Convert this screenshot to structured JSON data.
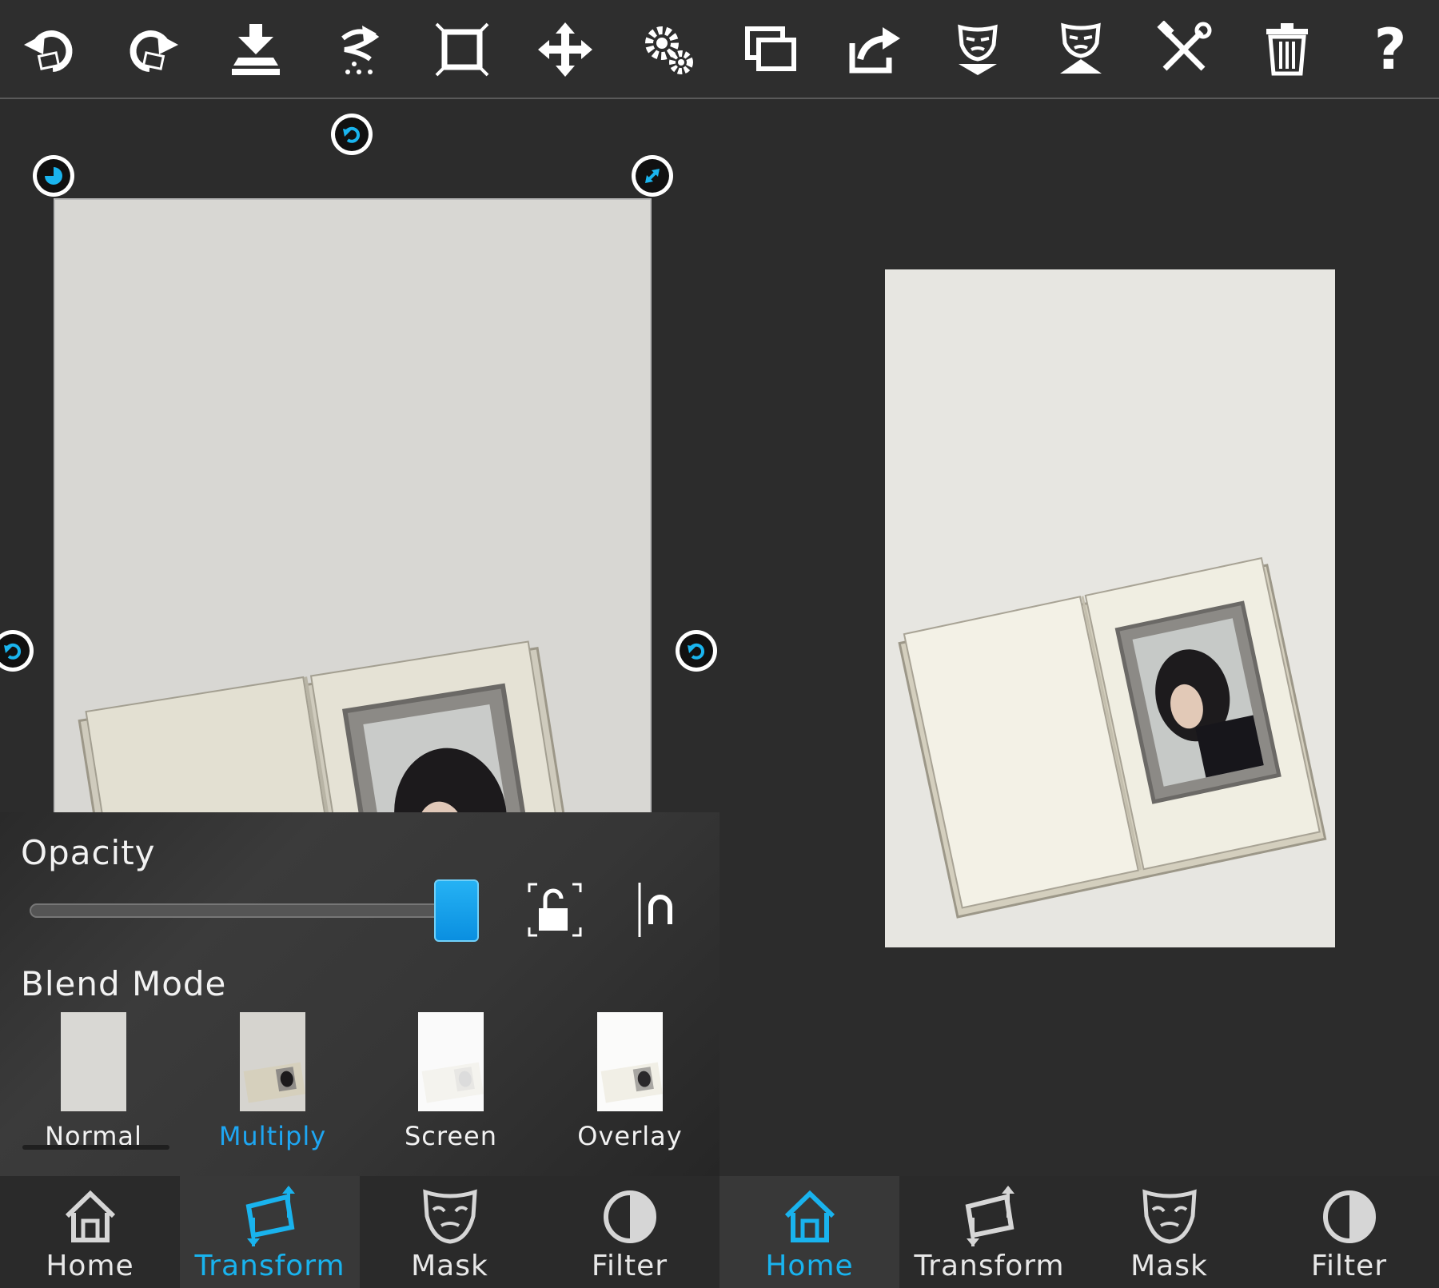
{
  "toolbar": {
    "buttons": [
      {
        "name": "undo-icon"
      },
      {
        "name": "redo-icon"
      },
      {
        "name": "merge-down-icon"
      },
      {
        "name": "warp-icon"
      },
      {
        "name": "fit-frame-icon"
      },
      {
        "name": "move-icon"
      },
      {
        "name": "settings-icon"
      },
      {
        "name": "duplicate-layer-icon"
      },
      {
        "name": "export-icon"
      },
      {
        "name": "mask-down-icon"
      },
      {
        "name": "mask-up-icon"
      },
      {
        "name": "tools-icon"
      },
      {
        "name": "delete-icon"
      },
      {
        "name": "help-icon"
      }
    ],
    "help_glyph": "?"
  },
  "panel": {
    "opacity_label": "Opacity",
    "opacity_value": 1.0,
    "blend_label": "Blend Mode",
    "blend_modes": [
      {
        "label": "Normal",
        "selected": false
      },
      {
        "label": "Multiply",
        "selected": true
      },
      {
        "label": "Screen",
        "selected": false
      },
      {
        "label": "Overlay",
        "selected": false
      }
    ]
  },
  "nav_left": {
    "items": [
      {
        "label": "Home",
        "active": false
      },
      {
        "label": "Transform",
        "active": true
      },
      {
        "label": "Mask",
        "active": false
      },
      {
        "label": "Filter",
        "active": false
      }
    ]
  },
  "nav_right": {
    "items": [
      {
        "label": "Home",
        "active": true
      },
      {
        "label": "Transform",
        "active": false
      },
      {
        "label": "Mask",
        "active": false
      },
      {
        "label": "Filter",
        "active": false
      }
    ]
  },
  "colors": {
    "accent": "#19b3ee",
    "background": "#2c2c2c",
    "panel": "#363636"
  }
}
